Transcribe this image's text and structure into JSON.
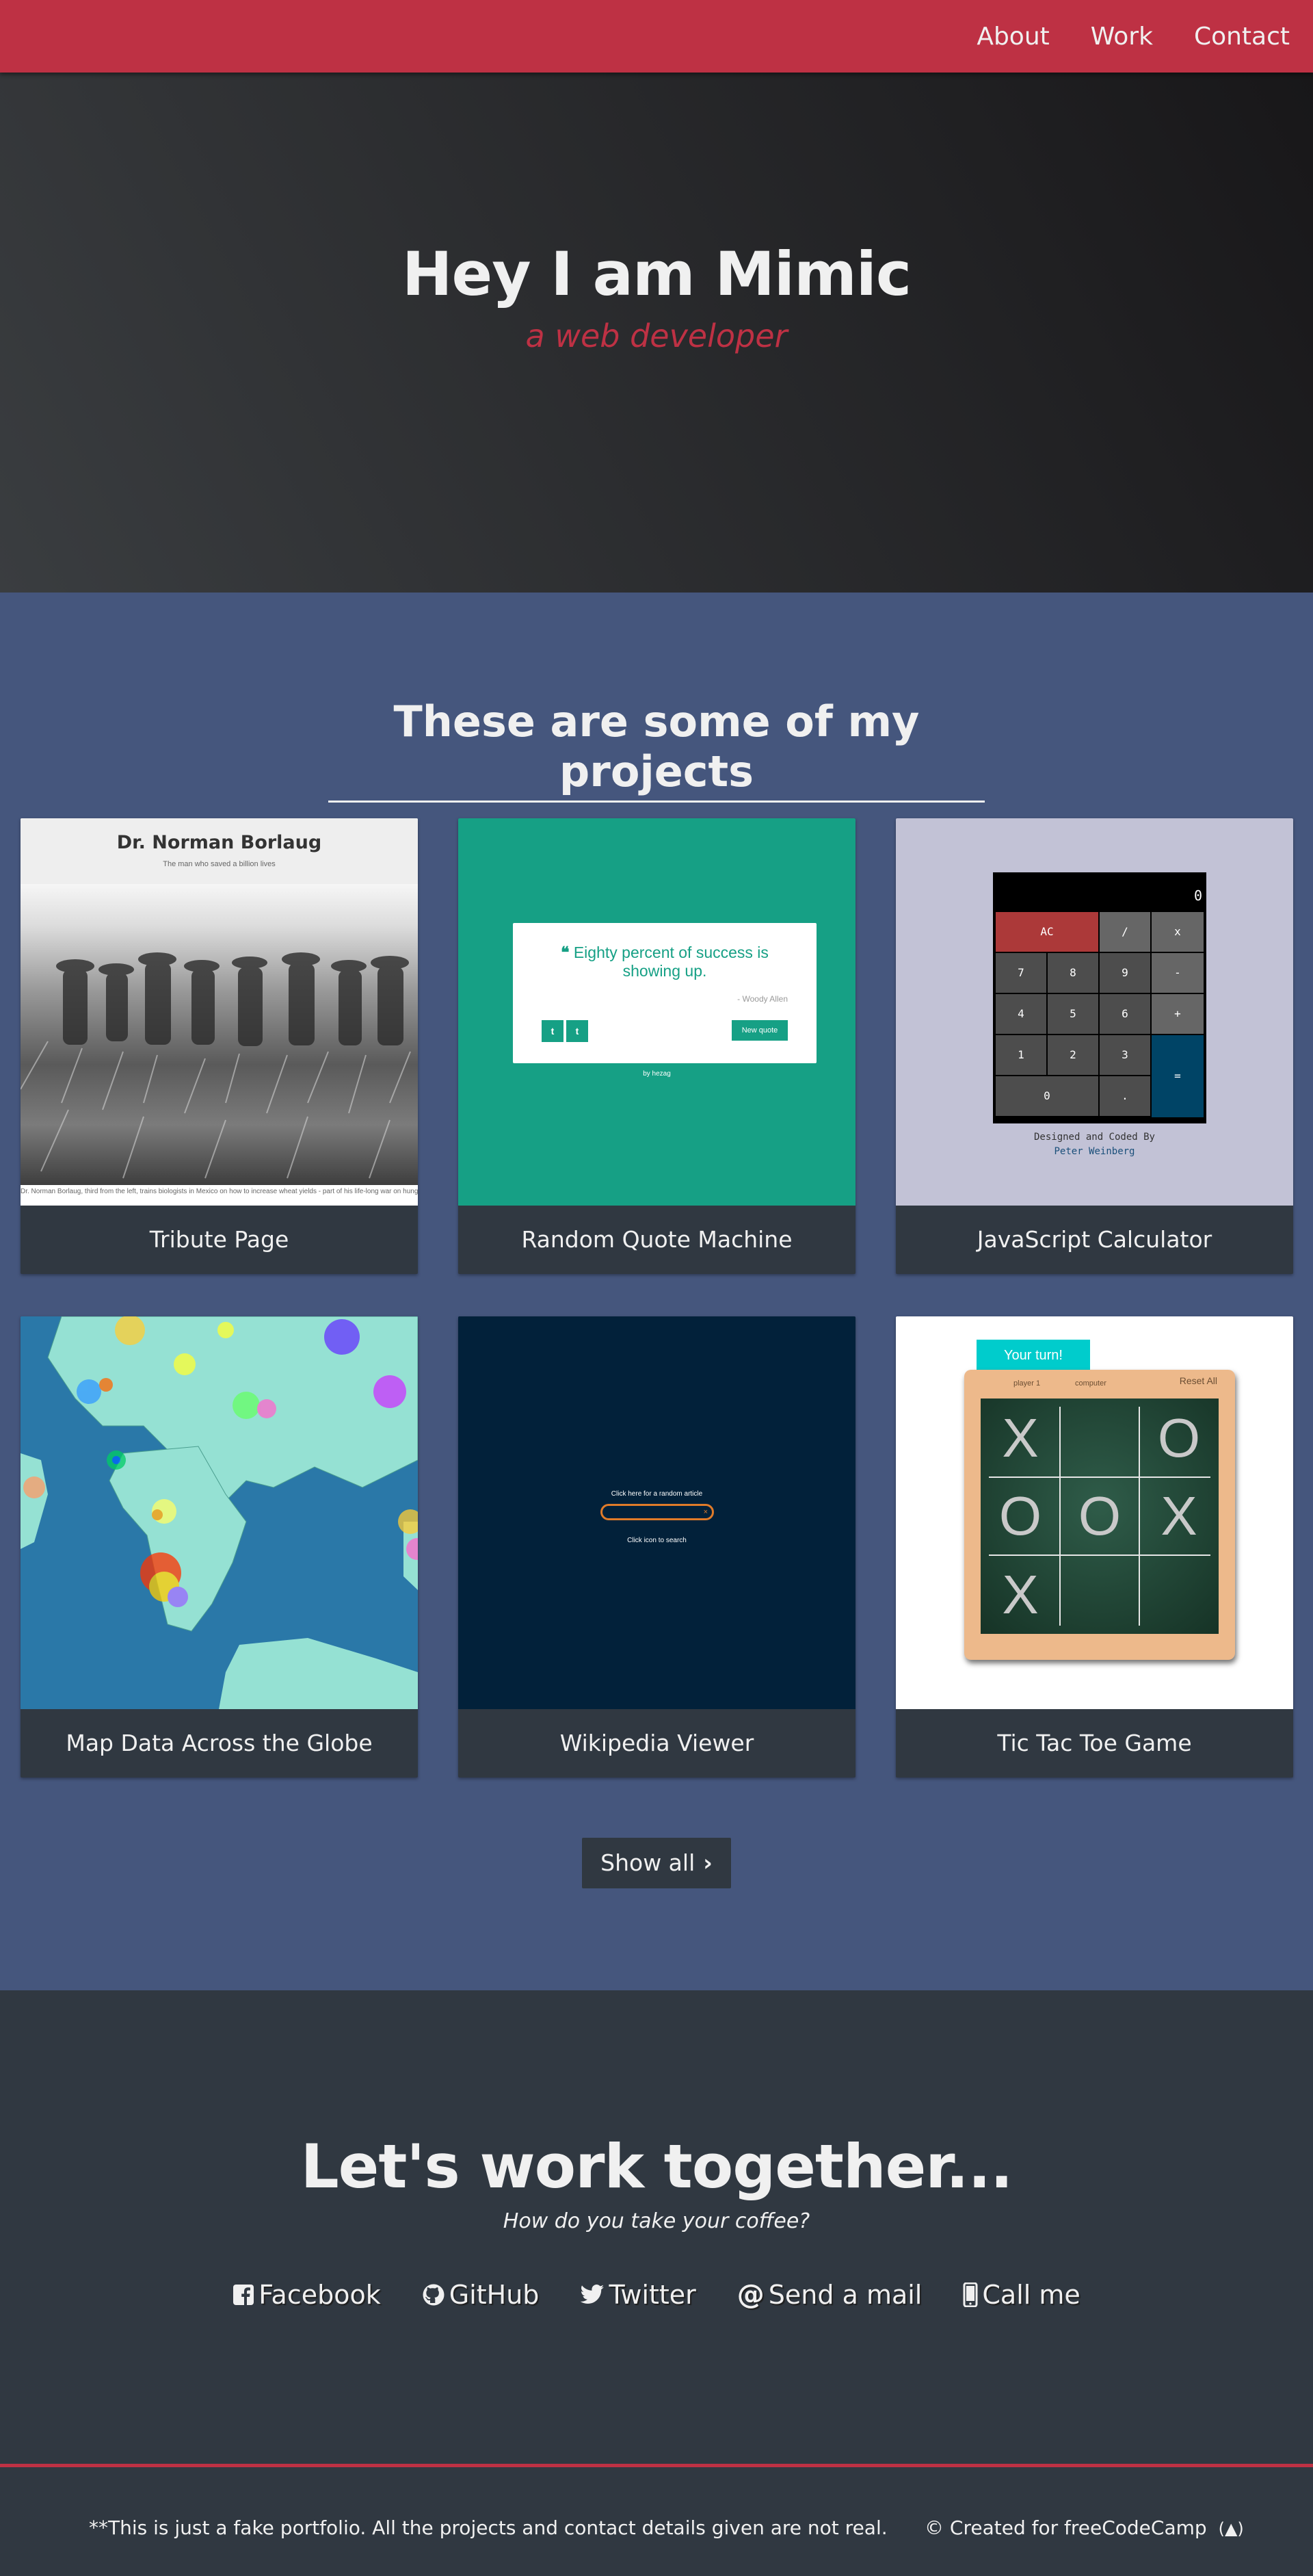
{
  "nav": {
    "links": [
      "About",
      "Work",
      "Contact"
    ]
  },
  "hero": {
    "title": "Hey I am Mimic",
    "subtitle": "a web developer"
  },
  "projects": {
    "header": "These are some of my projects",
    "tiles": [
      {
        "title": "Tribute Page",
        "preview_heading": "Dr. Norman Borlaug",
        "preview_subheading": "The man who saved a billion lives",
        "preview_caption": "Dr. Norman Borlaug, third from the left, trains biologists in Mexico on how to increase wheat yields - part of his life-long war on hunger."
      },
      {
        "title": "Random Quote Machine",
        "preview_quote": "Eighty percent of success is showing up.",
        "preview_author": "- Woody Allen",
        "preview_button": "New quote",
        "preview_twitter": "t",
        "preview_tumblr": "t",
        "preview_credit": "by hezag"
      },
      {
        "title": "JavaScript Calculator",
        "preview_display": "0",
        "preview_keys": [
          "AC",
          "/",
          "x",
          "7",
          "8",
          "9",
          "-",
          "4",
          "5",
          "6",
          "+",
          "1",
          "2",
          "3",
          "=",
          "0",
          "."
        ],
        "preview_credit_1": "Designed and Coded By",
        "preview_credit_2": "Peter Weinberg"
      },
      {
        "title": "Map Data Across the Globe"
      },
      {
        "title": "Wikipedia Viewer",
        "preview_random": "Click here for a random article",
        "preview_search_hint": "Click icon to search",
        "preview_clear": "×"
      },
      {
        "title": "Tic Tac Toe Game",
        "preview_turn": "Your turn!",
        "preview_reset": "Reset All",
        "preview_player": "player 1",
        "preview_computer": "computer",
        "preview_board": [
          "X",
          "",
          "O",
          "O",
          "O",
          "X",
          "X",
          "",
          ""
        ]
      }
    ],
    "show_all": "Show all"
  },
  "contact": {
    "title": "Let's work together...",
    "subtitle": "How do you take your coffee?",
    "links": [
      {
        "label": "Facebook",
        "icon": "facebook-icon"
      },
      {
        "label": "GitHub",
        "icon": "github-icon"
      },
      {
        "label": "Twitter",
        "icon": "twitter-icon"
      },
      {
        "label": "Send a mail",
        "icon": "at-icon"
      },
      {
        "label": "Call me",
        "icon": "mobile-phone-icon"
      }
    ]
  },
  "footer": {
    "disclaimer": "**This is just a fake portfolio. All the projects and contact details given are not real.",
    "credit": "© Created for freeCodeCamp"
  },
  "colors": {
    "brand_red": "#be3144",
    "projects_bg": "#45567d",
    "dark": "#303841",
    "quote_green": "#16a085",
    "calc_bg": "#c2c2d6",
    "wiki_bg": "#02213a"
  }
}
